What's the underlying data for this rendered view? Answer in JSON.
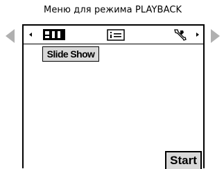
{
  "header": {
    "caption": "Меню для режима PLAYBACK"
  },
  "navigation": {
    "prev_icon": "triangle-left-icon",
    "next_icon": "triangle-right-icon"
  },
  "menu": {
    "tabs": [
      {
        "icon": "playback-tab-icon",
        "selected": true
      },
      {
        "icon": "info-list-icon",
        "selected": false
      },
      {
        "icon": "settings-wrench-icon",
        "selected": false
      }
    ],
    "slideshow_label": "Slide Show",
    "start_label": "Start"
  },
  "colors": {
    "nav_arrow": "#b0b0b0",
    "button_bg": "#d9d9d9",
    "border": "#000000"
  }
}
